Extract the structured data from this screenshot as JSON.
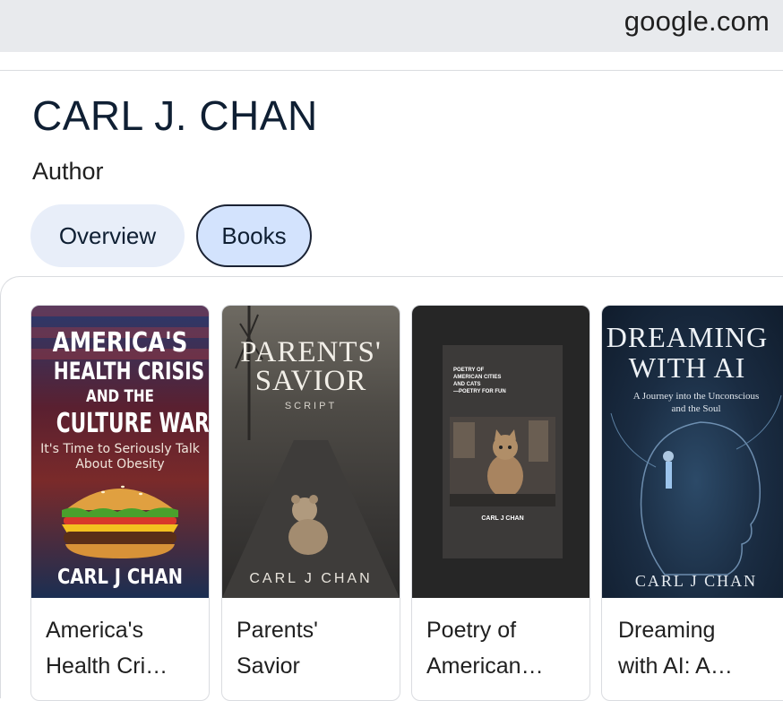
{
  "browser": {
    "domain": "google.com"
  },
  "panel": {
    "title": "CARL J. CHAN",
    "subtitle": "Author",
    "tabs": [
      {
        "label": "Overview",
        "selected": false
      },
      {
        "label": "Books",
        "selected": true
      }
    ]
  },
  "books": [
    {
      "title_line1": "America's",
      "title_line2": "Health Cri…",
      "cover": {
        "line1": "AMERICA'S",
        "line2": "HEALTH CRISIS",
        "line3": "AND THE",
        "line4": "CULTURE WAR",
        "tagline1": "It's Time to Seriously Talk",
        "tagline2": "About Obesity",
        "author": "CARL J CHAN"
      }
    },
    {
      "title_line1": "Parents'",
      "title_line2": "Savior",
      "cover": {
        "line1": "PARENTS'",
        "line2": "SAVIOR",
        "sub": "SCRIPT",
        "author": "CARL J CHAN"
      }
    },
    {
      "title_line1": "Poetry of",
      "title_line2": "American…",
      "cover": {
        "line1": "POETRY OF",
        "line2": "AMERICAN CITIES",
        "line3": "AND CATS",
        "line4": "—POETRY FOR FUN",
        "author": "CARL J CHAN"
      }
    },
    {
      "title_line1": "Dreaming",
      "title_line2": "with AI: A…",
      "cover": {
        "line1": "DREAMING",
        "line2": "WITH AI",
        "sub1": "A Journey into the Unconscious",
        "sub2": "and the Soul",
        "author": "CARL J CHAN"
      }
    }
  ],
  "colors": {
    "address_bar_bg": "#e8eaed",
    "chip_bg": "#e8eef9",
    "chip_selected_bg": "#d3e3fd",
    "title_text": "#0f1f33"
  }
}
